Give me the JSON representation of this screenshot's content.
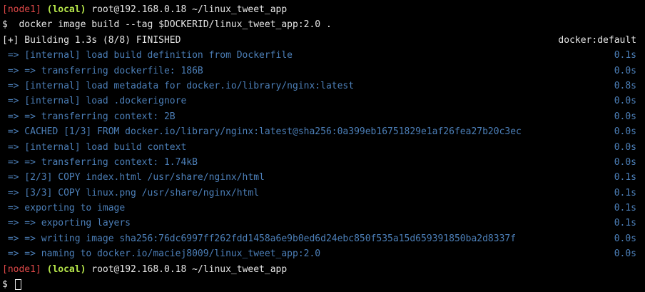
{
  "colors": {
    "background": "#000000",
    "node": "#e04848",
    "local": "#b6e64a",
    "text": "#e6e6e6",
    "dim": "#4c7fb8"
  },
  "prompt1": {
    "node": "[node1]",
    "local": "(local)",
    "host": "root@192.168.0.18",
    "cwd": "~/linux_tweet_app"
  },
  "command": "$  docker image build --tag $DOCKERID/linux_tweet_app:2.0 .",
  "building": {
    "text": "[+] Building 1.3s (8/8) FINISHED",
    "target": "docker:default"
  },
  "steps": [
    {
      "text": " => [internal] load build definition from Dockerfile",
      "time": "0.1s"
    },
    {
      "text": " => => transferring dockerfile: 186B",
      "time": "0.0s"
    },
    {
      "text": " => [internal] load metadata for docker.io/library/nginx:latest",
      "time": "0.8s"
    },
    {
      "text": " => [internal] load .dockerignore",
      "time": "0.0s"
    },
    {
      "text": " => => transferring context: 2B",
      "time": "0.0s"
    },
    {
      "text": " => CACHED [1/3] FROM docker.io/library/nginx:latest@sha256:0a399eb16751829e1af26fea27b20c3ec",
      "time": "0.0s"
    },
    {
      "text": " => [internal] load build context",
      "time": "0.0s"
    },
    {
      "text": " => => transferring context: 1.74kB",
      "time": "0.0s"
    },
    {
      "text": " => [2/3] COPY index.html /usr/share/nginx/html",
      "time": "0.1s"
    },
    {
      "text": " => [3/3] COPY linux.png /usr/share/nginx/html",
      "time": "0.1s"
    },
    {
      "text": " => exporting to image",
      "time": "0.1s"
    },
    {
      "text": " => => exporting layers",
      "time": "0.1s"
    },
    {
      "text": " => => writing image sha256:76dc6997ff262fdd1458a6e9b0ed6d24ebc850f535a15d659391850ba2d8337f",
      "time": "0.0s"
    },
    {
      "text": " => => naming to docker.io/maciej8009/linux_tweet_app:2.0",
      "time": "0.0s"
    }
  ],
  "prompt2": {
    "node": "[node1]",
    "local": "(local)",
    "host": "root@192.168.0.18",
    "cwd": "~/linux_tweet_app"
  },
  "input_prompt": "$ "
}
